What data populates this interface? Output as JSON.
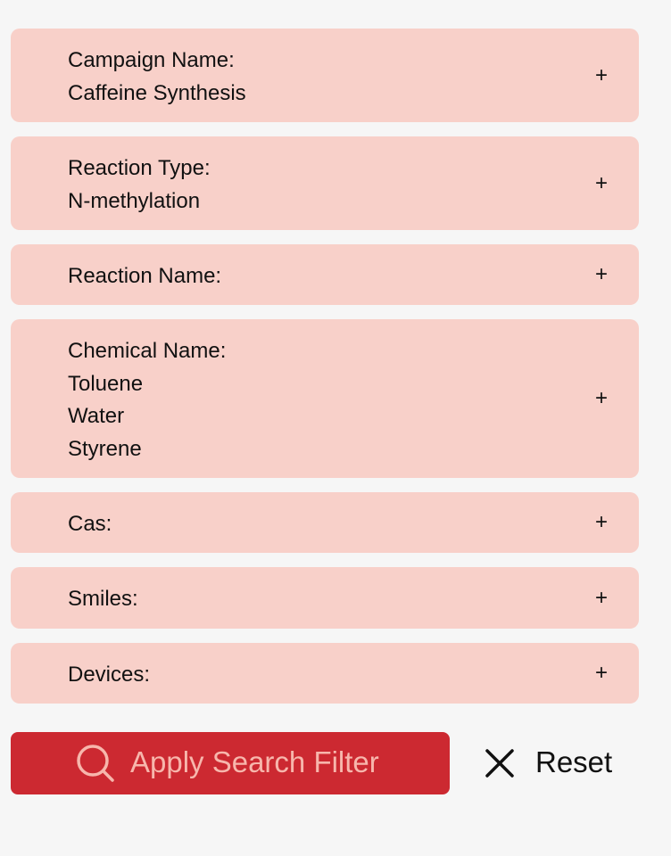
{
  "filters": [
    {
      "label": "Campaign Name:",
      "values": [
        "Caffeine Synthesis"
      ],
      "toggle": "+"
    },
    {
      "label": "Reaction Type:",
      "values": [
        "N-methylation"
      ],
      "toggle": "+"
    },
    {
      "label": "Reaction Name:",
      "values": [],
      "toggle": "+"
    },
    {
      "label": "Chemical Name:",
      "values": [
        "Toluene",
        "Water",
        "Styrene"
      ],
      "toggle": "+"
    },
    {
      "label": "Cas:",
      "values": [],
      "toggle": "+"
    },
    {
      "label": "Smiles:",
      "values": [],
      "toggle": "+"
    },
    {
      "label": "Devices:",
      "values": [],
      "toggle": "+"
    }
  ],
  "actions": {
    "apply_label": "Apply Search Filter",
    "apply_icon": "search-icon",
    "reset_label": "Reset",
    "reset_icon": "close-icon"
  },
  "colors": {
    "page_background": "#f6f6f6",
    "panel_background": "#f8d0c9",
    "apply_background": "#cc2931",
    "apply_foreground": "#f7b6ac",
    "text": "#111111"
  }
}
